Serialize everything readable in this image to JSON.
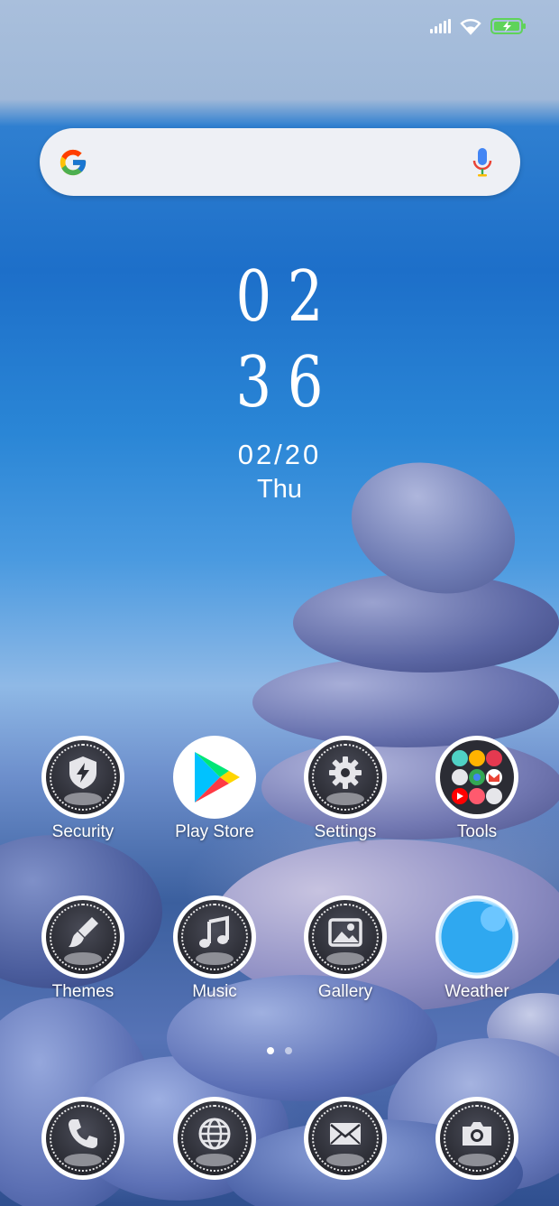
{
  "status_bar": {
    "signal_icon": "cell-signal-icon",
    "wifi_icon": "wifi-icon",
    "battery_icon": "battery-charging-icon",
    "battery_color": "#5fd35a"
  },
  "search": {
    "logo": "google-logo",
    "mic": "microphone-icon",
    "placeholder": ""
  },
  "clock": {
    "hour": "02",
    "minute": "36",
    "date": "02/20",
    "day": "Thu"
  },
  "apps": {
    "row1": [
      {
        "label": "Security",
        "icon": "shield-bolt-icon"
      },
      {
        "label": "Play Store",
        "icon": "play-store-icon"
      },
      {
        "label": "Settings",
        "icon": "gear-icon"
      },
      {
        "label": "Tools",
        "icon": "tools-folder-icon"
      }
    ],
    "row2": [
      {
        "label": "Themes",
        "icon": "paintbrush-icon"
      },
      {
        "label": "Music",
        "icon": "music-note-icon"
      },
      {
        "label": "Gallery",
        "icon": "image-icon"
      },
      {
        "label": "Weather",
        "icon": "weather-icon"
      }
    ]
  },
  "dock": [
    {
      "icon": "phone-icon"
    },
    {
      "icon": "globe-icon"
    },
    {
      "icon": "mail-icon"
    },
    {
      "icon": "camera-icon"
    }
  ],
  "pager": {
    "pages": 2,
    "active": 1
  }
}
